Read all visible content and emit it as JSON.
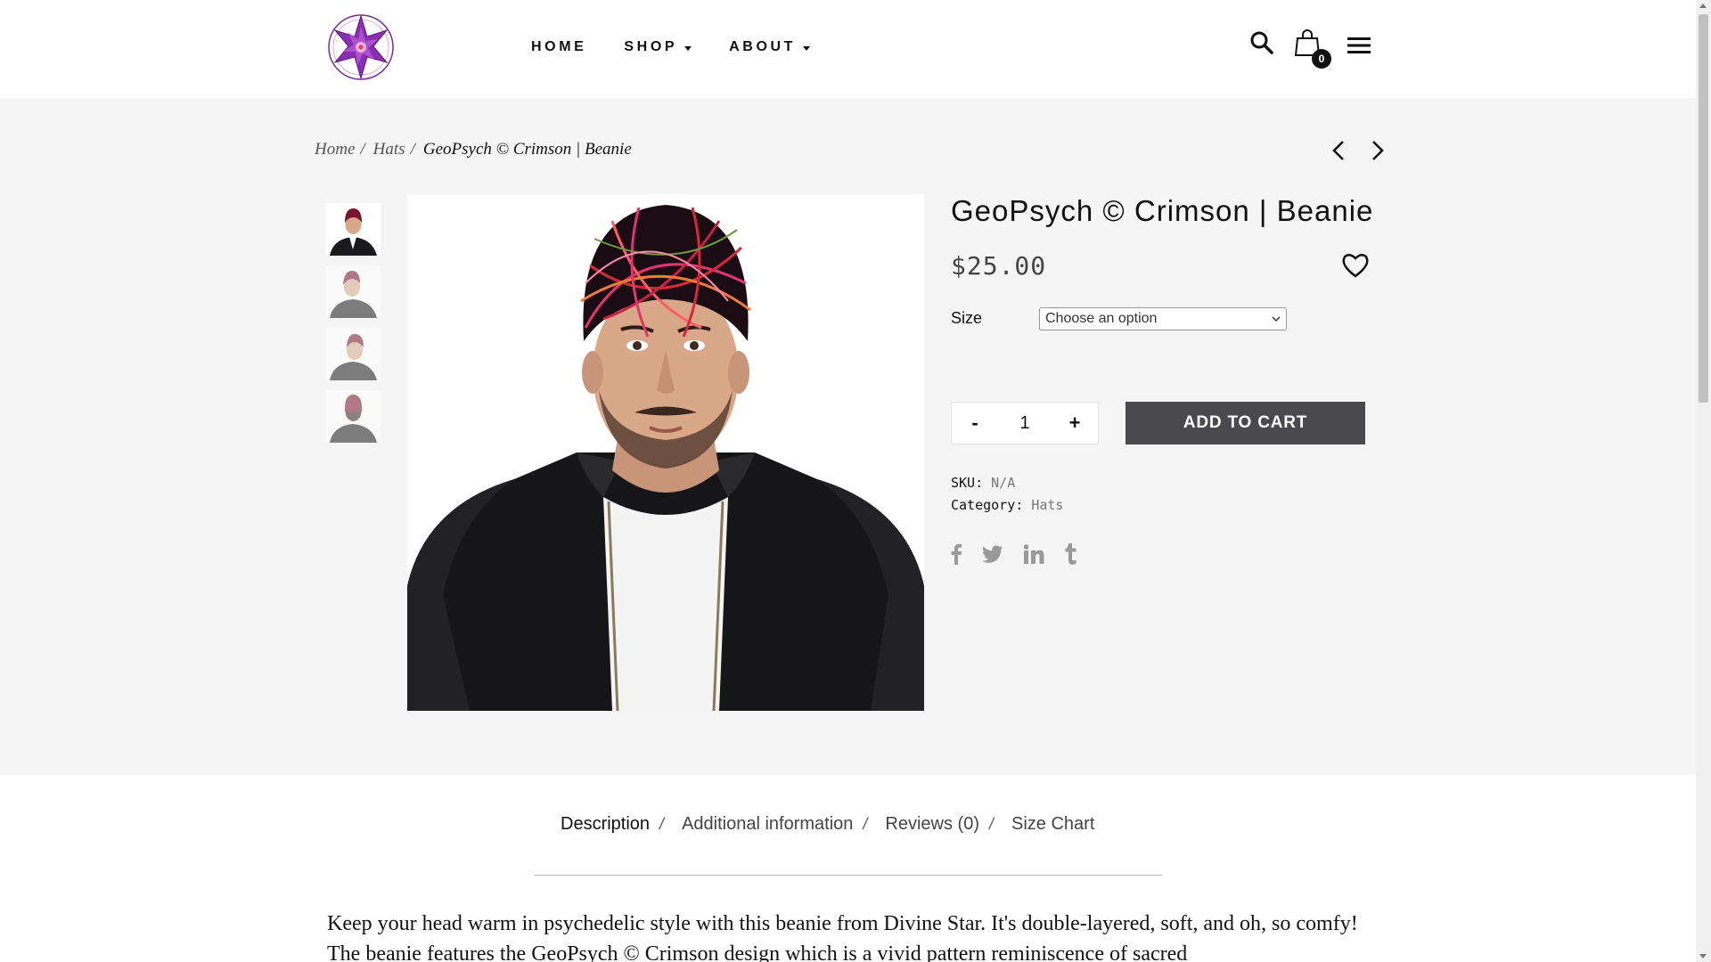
{
  "nav": {
    "home": "HOME",
    "shop": "SHOP",
    "about": "ABOUT"
  },
  "cart": {
    "count": "0"
  },
  "breadcrumb": {
    "home": "Home",
    "sep": "/",
    "category": "Hats",
    "current": "GeoPsych © Crimson | Beanie"
  },
  "product": {
    "title": "GeoPsych © Crimson | Beanie",
    "price": "$25.00",
    "size_label": "Size",
    "size_placeholder": "Choose an option",
    "qty_minus": "-",
    "qty_value": "1",
    "qty_plus": "+",
    "add_to_cart": "ADD TO CART",
    "sku_label": "SKU:",
    "sku_value": "N/A",
    "category_label": "Category:",
    "category_value": "Hats"
  },
  "tabs": {
    "description": "Description",
    "additional": "Additional information",
    "reviews": "Reviews (0)",
    "size_chart": "Size Chart",
    "sep": "/"
  },
  "description": "Keep your head warm in psychedelic style with this beanie from Divine Star. It's double-layered, soft, and oh, so comfy! The beanie features the GeoPsych © Crimson design which is a vivid pattern reminiscence of sacred",
  "colors": {
    "button": "#4a4a4c",
    "logo_purple": "#8a2fb3",
    "accent_pink": "#e0356f"
  },
  "icons": {
    "search": "search-icon",
    "cart": "shopping-bag-icon",
    "menu": "hamburger-menu-icon",
    "wishlist": "heart-icon",
    "prev": "chevron-left-icon",
    "next": "chevron-right-icon",
    "facebook": "facebook-icon",
    "twitter": "twitter-icon",
    "linkedin": "linkedin-icon",
    "tumblr": "tumblr-icon"
  }
}
